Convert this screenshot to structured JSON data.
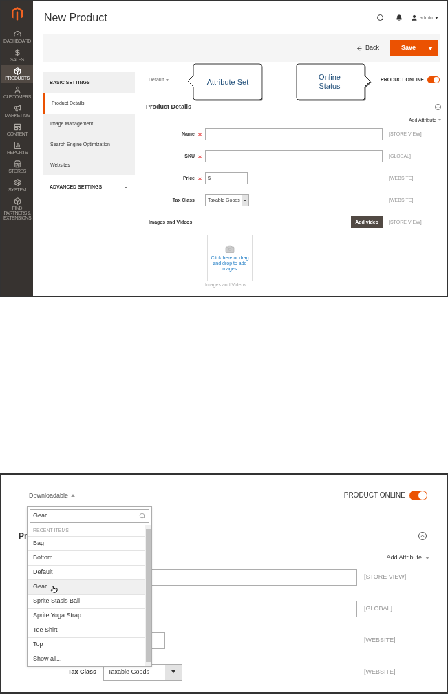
{
  "screenshot_1": {
    "sidebar": {
      "items": [
        {
          "label": "DASHBOARD",
          "kind": "gauge",
          "selected": false
        },
        {
          "label": "SALES",
          "kind": "dollar",
          "selected": false
        },
        {
          "label": "PRODUCTS",
          "kind": "package",
          "selected": true
        },
        {
          "label": "CUSTOMERS",
          "kind": "person",
          "selected": false
        },
        {
          "label": "MARKETING",
          "kind": "megaphone",
          "selected": false
        },
        {
          "label": "CONTENT",
          "kind": "layout",
          "selected": false
        },
        {
          "label": "REPORTS",
          "kind": "chart",
          "selected": false
        },
        {
          "label": "STORES",
          "kind": "store",
          "selected": false
        },
        {
          "label": "SYSTEM",
          "kind": "gear",
          "selected": false
        },
        {
          "label": "FIND PARTNERS & EXTENSIONS",
          "kind": "cube",
          "selected": false
        }
      ]
    },
    "page_title": "New Product",
    "header": {
      "user": "admin"
    },
    "actions": {
      "back": "Back",
      "save": "Save"
    },
    "nav": {
      "sections": [
        {
          "title": "BASIC SETTINGS",
          "expanded": true,
          "items": [
            {
              "label": "Product Details",
              "selected": true
            },
            {
              "label": "Image Management",
              "selected": false
            },
            {
              "label": "Search Engine Optimization",
              "selected": false
            },
            {
              "label": "Websites",
              "selected": false
            }
          ]
        },
        {
          "title": "ADVANCED SETTINGS",
          "expanded": false
        }
      ]
    },
    "attribute_set": "Default",
    "callouts": [
      {
        "text": "Attribute Set"
      },
      {
        "text": "Online Status"
      }
    ],
    "product_online": {
      "label": "PRODUCT ONLINE",
      "on": true
    },
    "section": {
      "title": "Product Details",
      "add_attribute": "Add Attribute",
      "fields": [
        {
          "label": "Name",
          "required": true,
          "kind": "text",
          "scope": "[STORE VIEW]"
        },
        {
          "label": "SKU",
          "required": true,
          "kind": "text",
          "scope": "[GLOBAL]"
        },
        {
          "label": "Price",
          "required": true,
          "kind": "price",
          "prefix": "$",
          "scope": "[WEBSITE]"
        },
        {
          "label": "Tax Class",
          "required": false,
          "kind": "select",
          "value": "Taxable Goods",
          "scope": "[WEBSITE]"
        }
      ],
      "images": {
        "label": "Images and Videos",
        "button": "Add video",
        "scope": "[STORE VIEW]",
        "upload_text": "Click here or drag and drop to add images.",
        "caption": "Images and Videos"
      }
    }
  },
  "screenshot_2": {
    "attribute_set": "Downloadable",
    "dropdown": {
      "expanded": true,
      "search_value": "Gear",
      "group_label": "RECENT ITEMS",
      "options": [
        {
          "label": "Bag",
          "selected": false
        },
        {
          "label": "Bottom",
          "selected": false
        },
        {
          "label": "Default",
          "selected": false
        },
        {
          "label": "Gear",
          "selected": true
        },
        {
          "label": "Sprite Stasis Ball",
          "selected": false
        },
        {
          "label": "Sprite Yoga Strap",
          "selected": false
        },
        {
          "label": "Tee Shirt",
          "selected": false
        },
        {
          "label": "Top",
          "selected": false
        }
      ],
      "show_all": "Show all..."
    },
    "product_online": {
      "label": "PRODUCT ONLINE",
      "on": true
    },
    "section_title": "Pr",
    "add_attribute": "Add Attribute",
    "fields": [
      {
        "kind": "text",
        "scope": "[STORE VIEW]"
      },
      {
        "kind": "text",
        "scope": "[GLOBAL]"
      },
      {
        "kind": "price",
        "scope": "[WEBSITE]"
      },
      {
        "kind": "select",
        "label": "Tax Class",
        "value": "Taxable Goods",
        "scope": "[WEBSITE]"
      }
    ]
  }
}
